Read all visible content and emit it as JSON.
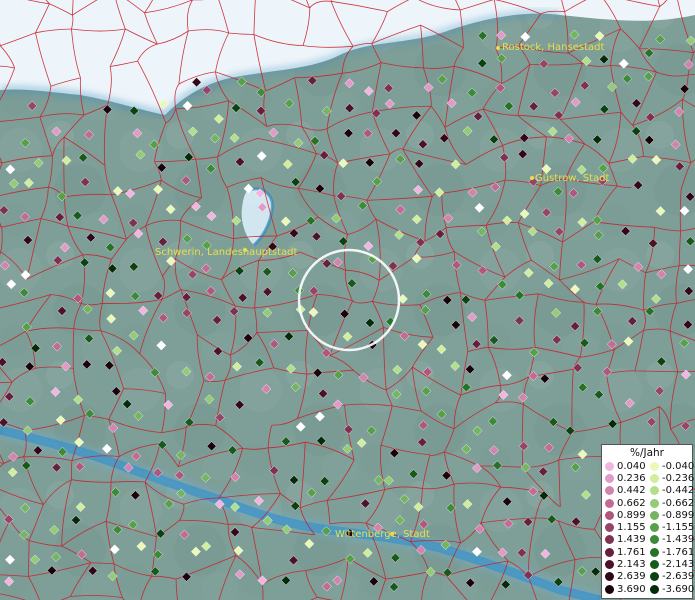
{
  "cities": [
    {
      "id": "rostock",
      "name": "Rostock, Hansestadt"
    },
    {
      "id": "guestrow",
      "name": "Güstrow, Stadt"
    },
    {
      "id": "schwerin",
      "name": "Schwerin, Landeshauptstadt"
    },
    {
      "id": "wittenberge",
      "name": "Wittenberge, Stadt"
    }
  ],
  "legend": {
    "title": "%/Jahr",
    "positive": [
      {
        "label": "0.040",
        "color": "#f2b4e0"
      },
      {
        "label": "0.236",
        "color": "#e39ac8"
      },
      {
        "label": "0.442",
        "color": "#d482ae"
      },
      {
        "label": "0.662",
        "color": "#c46b95"
      },
      {
        "label": "0.899",
        "color": "#b0577d"
      },
      {
        "label": "1.155",
        "color": "#984467"
      },
      {
        "label": "1.439",
        "color": "#7e3151"
      },
      {
        "label": "1.761",
        "color": "#66203d"
      },
      {
        "label": "2.143",
        "color": "#4c1229"
      },
      {
        "label": "2.639",
        "color": "#33071a"
      },
      {
        "label": "3.690",
        "color": "#1a020b"
      }
    ],
    "negative": [
      {
        "label": "-0.040",
        "color": "#eaf8b8"
      },
      {
        "label": "-0.236",
        "color": "#d0ee9c"
      },
      {
        "label": "-0.442",
        "color": "#b2e08a"
      },
      {
        "label": "-0.662",
        "color": "#92cc74"
      },
      {
        "label": "-0.899",
        "color": "#74b660"
      },
      {
        "label": "-1.155",
        "color": "#56a04a"
      },
      {
        "label": "-1.439",
        "color": "#3d8a38"
      },
      {
        "label": "-1.761",
        "color": "#287228"
      },
      {
        "label": "-2.143",
        "color": "#185a1c"
      },
      {
        "label": "-2.639",
        "color": "#0c4212"
      },
      {
        "label": "-3.690",
        "color": "#042a08"
      }
    ]
  },
  "colors": {
    "land": "#7f9f99",
    "sea": "#eef5fa",
    "water": "#2f87bc",
    "borders": "#c8202a",
    "label": "#e6e04a",
    "marker_stroke": "#ffffff"
  }
}
